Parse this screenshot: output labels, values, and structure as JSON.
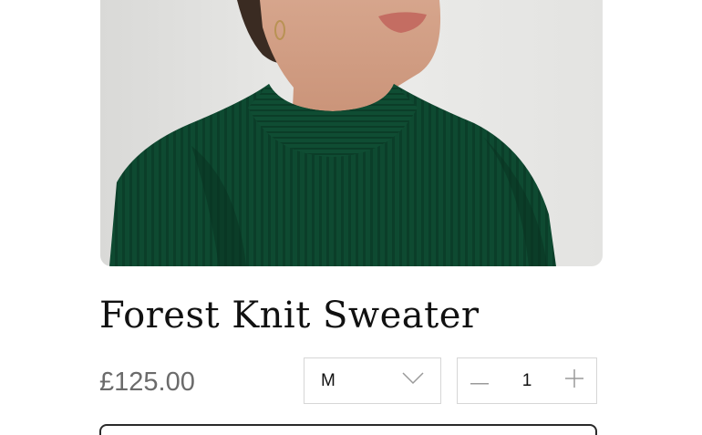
{
  "product": {
    "title": "Forest Knit Sweater",
    "price": "£125.00",
    "image": {
      "subject": "green-knit-sweater-photo"
    }
  },
  "options": {
    "size": {
      "selected": "M",
      "icon": "chevron-down-icon"
    },
    "quantity": {
      "value": "1",
      "decrement_icon": "minus-icon",
      "increment_icon": "plus-icon"
    }
  },
  "colors": {
    "sweater": "#0e4a31",
    "background": "#e9e9e7",
    "price": "#6b6b6b",
    "border": "#d6d6d6"
  }
}
